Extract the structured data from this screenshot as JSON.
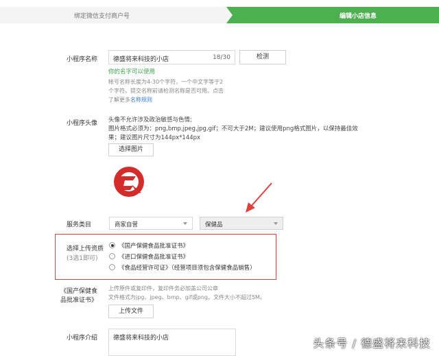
{
  "steps": [
    {
      "label": "绑定微信支付商户号",
      "active": false
    },
    {
      "label": "编辑小店信息",
      "active": true
    }
  ],
  "name_field": {
    "label": "小程序名称",
    "value": "德盛将来科技的小店",
    "counter": "18/30",
    "check_button": "检测",
    "status": "你的名字可以使用",
    "hint_line1": "帐号名称长度为4-30个字符，一个中文字等于2",
    "hint_line2": "个字符。提交名称前请检测名称是否可用。点击",
    "hint_line3_prefix": "了解更多",
    "hint_link": "名称规则"
  },
  "avatar": {
    "label": "小程序头像",
    "line1": "头像不允许涉及政治敏感与色情;",
    "line2": "图片格式必须为：png,bmp,jpeg,jpg,gif；不可大于2M；建议使用png格式图片，以保持最佳效",
    "line3": "果；建议图片尺寸为144px*144px",
    "button": "选择图片"
  },
  "service": {
    "label": "服务类目",
    "primary": "商家自营",
    "secondary": "保健品"
  },
  "qualification": {
    "label": "选择上传资质",
    "sublabel": "(3选1即可)",
    "options": [
      {
        "label": "《国产保健食品批准证书》",
        "selected": true
      },
      {
        "label": "《进口保健食品批准证书》",
        "selected": false
      },
      {
        "label": "《食品经营许可证》（经营项目须包含保健食品销售）",
        "selected": false
      }
    ]
  },
  "certificate": {
    "label_line1": "《国产保健食",
    "label_line2": "品批准证书》",
    "hint_line1": "上传原件或复印件，复印件务必加盖公司公章",
    "hint_line2": "文件格式为jpg、jpeg、bmp、gif或png，文件大小不超过5M。",
    "button": "上传文件"
  },
  "intro": {
    "label": "小程序介绍",
    "value": "德盛将来科技的小店"
  },
  "watermark": "头条号 / 德盛将来科技",
  "colors": {
    "accent": "#4caf50",
    "highlight": "#e04040",
    "link": "#3a7bd5"
  }
}
